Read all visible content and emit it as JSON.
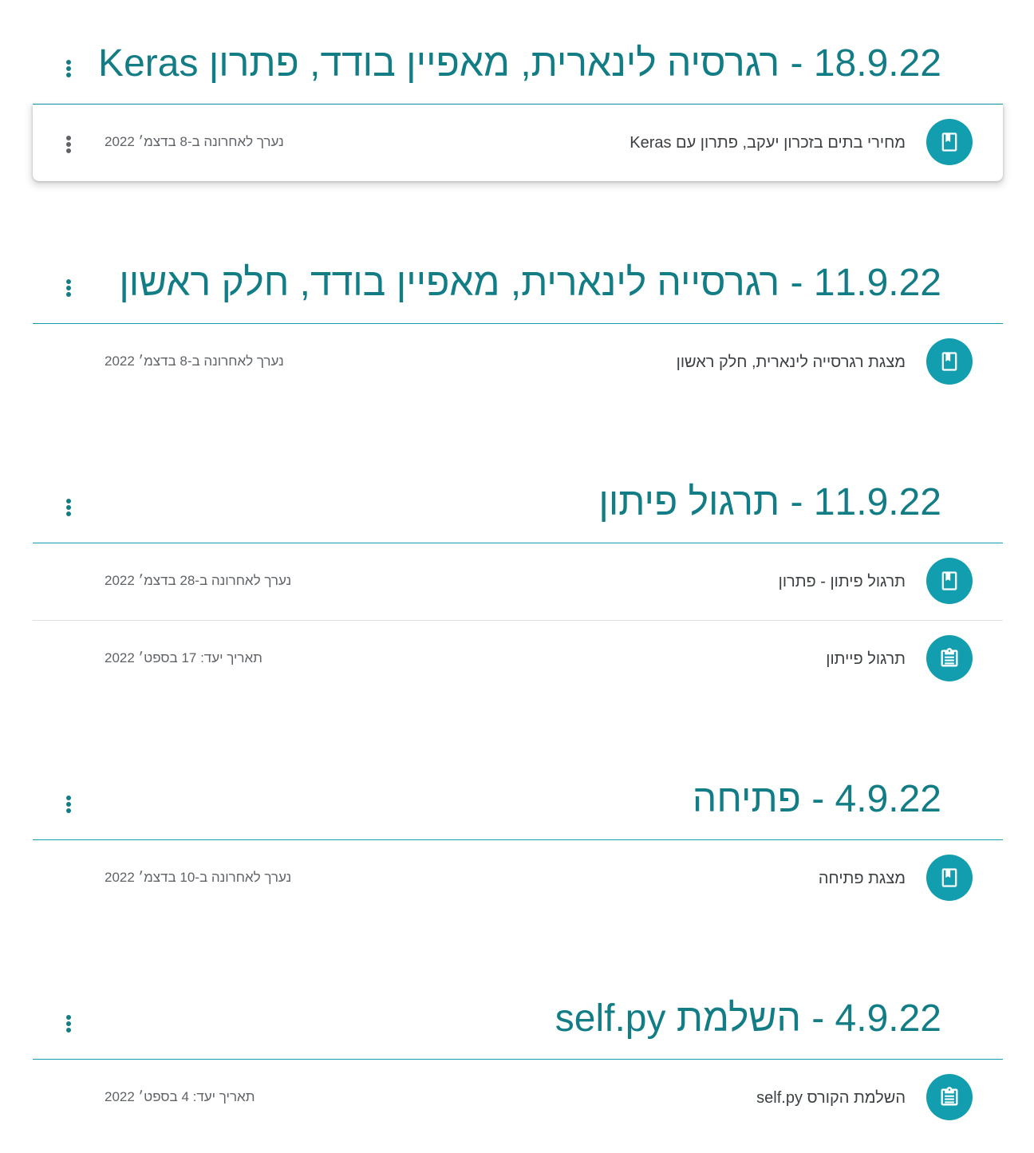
{
  "colors": {
    "accent": "#137d86",
    "icon_bg": "#129eaf",
    "divider": "#129eaf",
    "text_primary": "#3c4043",
    "text_secondary": "#5f6368"
  },
  "topics": [
    {
      "title": "18.9.22 - רגרסיה לינארית, מאפיין בודד, פתרון Keras",
      "options_icon": "more-vert-icon",
      "items": [
        {
          "type": "material",
          "icon": "book-icon",
          "title": "מחירי בתים בזכרון יעקב, פתרון עם Keras",
          "meta": "נערך לאחרונה ב-8 בדצמ׳ 2022",
          "active": true
        }
      ]
    },
    {
      "title": "11.9.22 - רגרסייה לינארית, מאפיין בודד, חלק ראשון",
      "options_icon": "more-vert-icon",
      "items": [
        {
          "type": "material",
          "icon": "book-icon",
          "title": "מצגת רגרסייה לינארית, חלק ראשון",
          "meta": "נערך לאחרונה ב-8 בדצמ׳ 2022"
        }
      ]
    },
    {
      "title": "11.9.22 - תרגול פיתון",
      "options_icon": "more-vert-icon",
      "items": [
        {
          "type": "material",
          "icon": "book-icon",
          "title": "תרגול פיתון - פתרון",
          "meta": "נערך לאחרונה ב-28 בדצמ׳ 2022"
        },
        {
          "type": "assignment",
          "icon": "assignment-icon",
          "title": "תרגול פייתון",
          "meta": "תאריך יעד: 17 בספט׳ 2022"
        }
      ]
    },
    {
      "title": "4.9.22 - פתיחה",
      "options_icon": "more-vert-icon",
      "items": [
        {
          "type": "material",
          "icon": "book-icon",
          "title": "מצגת פתיחה",
          "meta": "נערך לאחרונה ב-10 בדצמ׳ 2022"
        }
      ]
    },
    {
      "title": "4.9.22 - השלמת self.py",
      "options_icon": "more-vert-icon",
      "items": [
        {
          "type": "assignment",
          "icon": "assignment-icon",
          "title": "השלמת הקורס self.py",
          "meta": "תאריך יעד: 4 בספט׳ 2022"
        }
      ]
    }
  ]
}
